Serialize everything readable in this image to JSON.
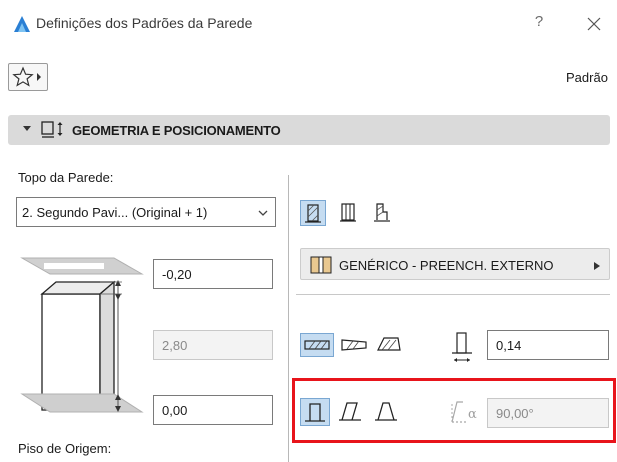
{
  "window": {
    "title": "Definições dos Padrões da Parede",
    "help_glyph": "?"
  },
  "toolbar": {
    "default_label": "Padrão"
  },
  "section": {
    "title": "GEOMETRIA E POSICIONAMENTO"
  },
  "left": {
    "top_label": "Topo da Parede:",
    "top_select_value": "2. Segundo Pavi... (Original + 1)",
    "top_offset": "-0,20",
    "height": "2,80",
    "base_offset": "0,00",
    "bottom_label": "Piso de Origem:"
  },
  "right": {
    "composite_label": "GENÉRICO - PREENCH. EXTERNO",
    "thickness": "0,14",
    "angle": "90,00°"
  },
  "colors": {
    "highlight": "#e8141b",
    "selected_bg": "#c5dcf1",
    "accent": "#2a7fd4"
  }
}
